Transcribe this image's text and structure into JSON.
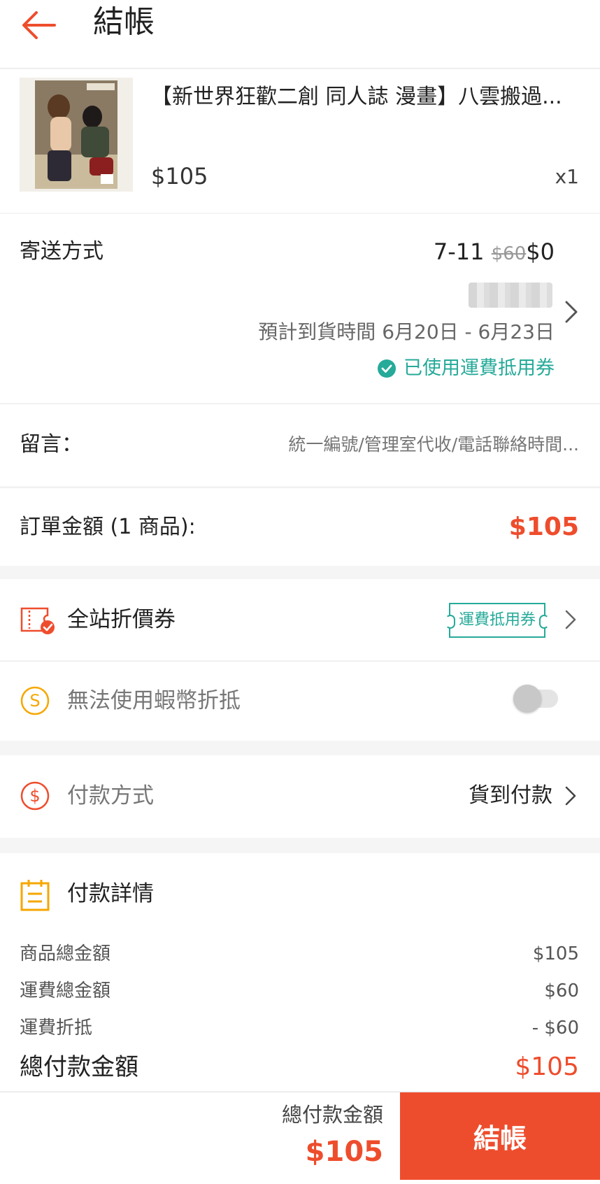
{
  "header": {
    "title": "結帳"
  },
  "product": {
    "name": "【新世界狂歡二創 同人誌 漫畫】八雲搬過...",
    "price": "$105",
    "quantity": "x1"
  },
  "shipping": {
    "label": "寄送方式",
    "method": "7-11",
    "original_fee": "$60",
    "fee": "$0",
    "eta": "預計到貨時間 6月20日 - 6月23日",
    "voucher_applied": "已使用運費抵用券"
  },
  "message": {
    "label": "留言：",
    "placeholder": "統一編號/管理室代收/電話聯絡時間..."
  },
  "order_total": {
    "label": "訂單金額 (1 商品):",
    "amount": "$105"
  },
  "voucher": {
    "label": "全站折價券",
    "tag": "運費抵用券"
  },
  "coins": {
    "label": "無法使用蝦幣折抵",
    "enabled": false
  },
  "payment": {
    "label": "付款方式",
    "value": "貨到付款"
  },
  "details": {
    "title": "付款詳情",
    "rows": [
      {
        "label": "商品總金額",
        "value": "$105"
      },
      {
        "label": "運費總金額",
        "value": "$60"
      },
      {
        "label": "運費折抵",
        "value": "- $60"
      }
    ],
    "grand_label": "總付款金額",
    "grand_value": "$105"
  },
  "bottom_bar": {
    "label": "總付款金額",
    "amount": "$105",
    "checkout": "結帳"
  },
  "colors": {
    "accent": "#ee4d2d",
    "teal": "#26aa99",
    "coin": "#f6a700",
    "details_icon": "#f6a700"
  }
}
